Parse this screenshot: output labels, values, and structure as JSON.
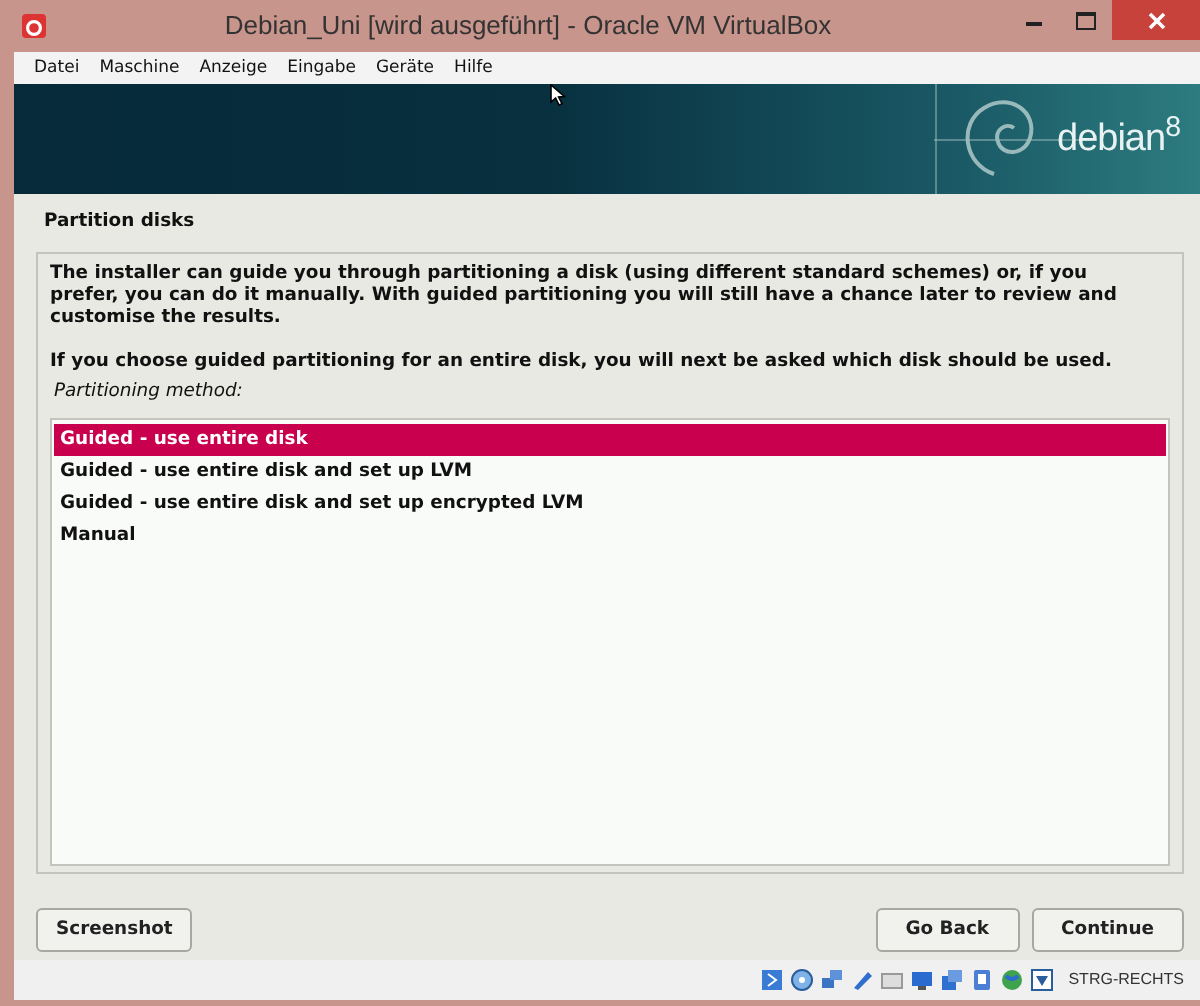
{
  "window": {
    "title": "Debian_Uni [wird ausgeführt] - Oracle VM VirtualBox"
  },
  "menu": [
    "Datei",
    "Maschine",
    "Anzeige",
    "Eingabe",
    "Geräte",
    "Hilfe"
  ],
  "banner": {
    "brand": "debian$^{8}$"
  },
  "installer": {
    "heading": "Partition disks",
    "paragraphs": [
      "The installer can guide you through partitioning a disk (using different standard schemes) or, if you prefer, you can do it manually. With guided partitioning you will still have a chance later to review and customise the results.",
      "If you choose guided partitioning for an entire disk, you will next be asked which disk should be used."
    ],
    "list_label": "Partitioning method:",
    "options": [
      {
        "label": "Guided - use entire disk",
        "selected": true
      },
      {
        "label": "Guided - use entire disk and set up LVM",
        "selected": false
      },
      {
        "label": "Guided - use entire disk and set up encrypted LVM",
        "selected": false
      },
      {
        "label": "Manual",
        "selected": false
      }
    ],
    "buttons": {
      "left": [
        "Screenshot"
      ],
      "right": [
        "Go Back",
        "Continue"
      ]
    }
  },
  "status_bar": {
    "host_key": "STRG-RECHTS"
  }
}
